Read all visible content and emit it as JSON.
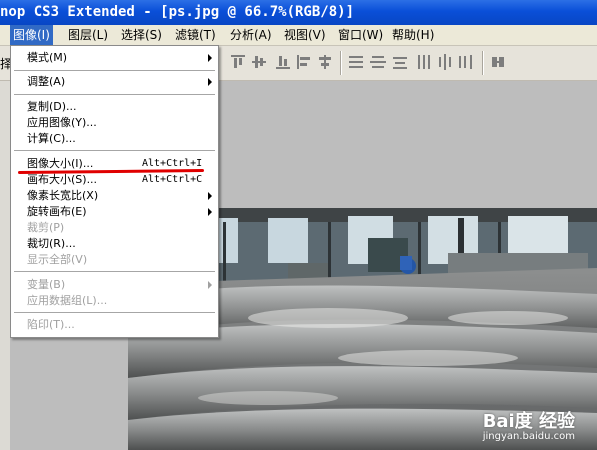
{
  "window": {
    "title": "nop CS3 Extended - [ps.jpg @ 66.7%(RGB/8)]"
  },
  "menubar": {
    "items": [
      {
        "label": "图像(I)"
      },
      {
        "label": "图层(L)"
      },
      {
        "label": "选择(S)"
      },
      {
        "label": "滤镜(T)"
      },
      {
        "label": "分析(A)"
      },
      {
        "label": "视图(V)"
      },
      {
        "label": "窗口(W)"
      },
      {
        "label": "帮助(H)"
      }
    ]
  },
  "dropdown": {
    "items": [
      {
        "label": "模式(M)"
      },
      {
        "label": "调整(A)"
      },
      {
        "label": "复制(D)..."
      },
      {
        "label": "应用图像(Y)..."
      },
      {
        "label": "计算(C)..."
      },
      {
        "label": "图像大小(I)...",
        "shortcut": "Alt+Ctrl+I"
      },
      {
        "label": "画布大小(S)...",
        "shortcut": "Alt+Ctrl+C"
      },
      {
        "label": "像素长宽比(X)"
      },
      {
        "label": "旋转画布(E)"
      },
      {
        "label": "裁剪(P)"
      },
      {
        "label": "裁切(R)..."
      },
      {
        "label": "显示全部(V)"
      },
      {
        "label": "变量(B)"
      },
      {
        "label": "应用数据组(L)..."
      },
      {
        "label": "陷印(T)..."
      }
    ]
  },
  "toolbar": {
    "left_label": "择"
  },
  "watermark": {
    "brand": "Bai度 经验",
    "sub": "jingyan.baidu.com"
  },
  "colors": {
    "titlebar": "#0a4fd8",
    "menu_highlight": "#316ac5",
    "annotation": "#e00000"
  }
}
